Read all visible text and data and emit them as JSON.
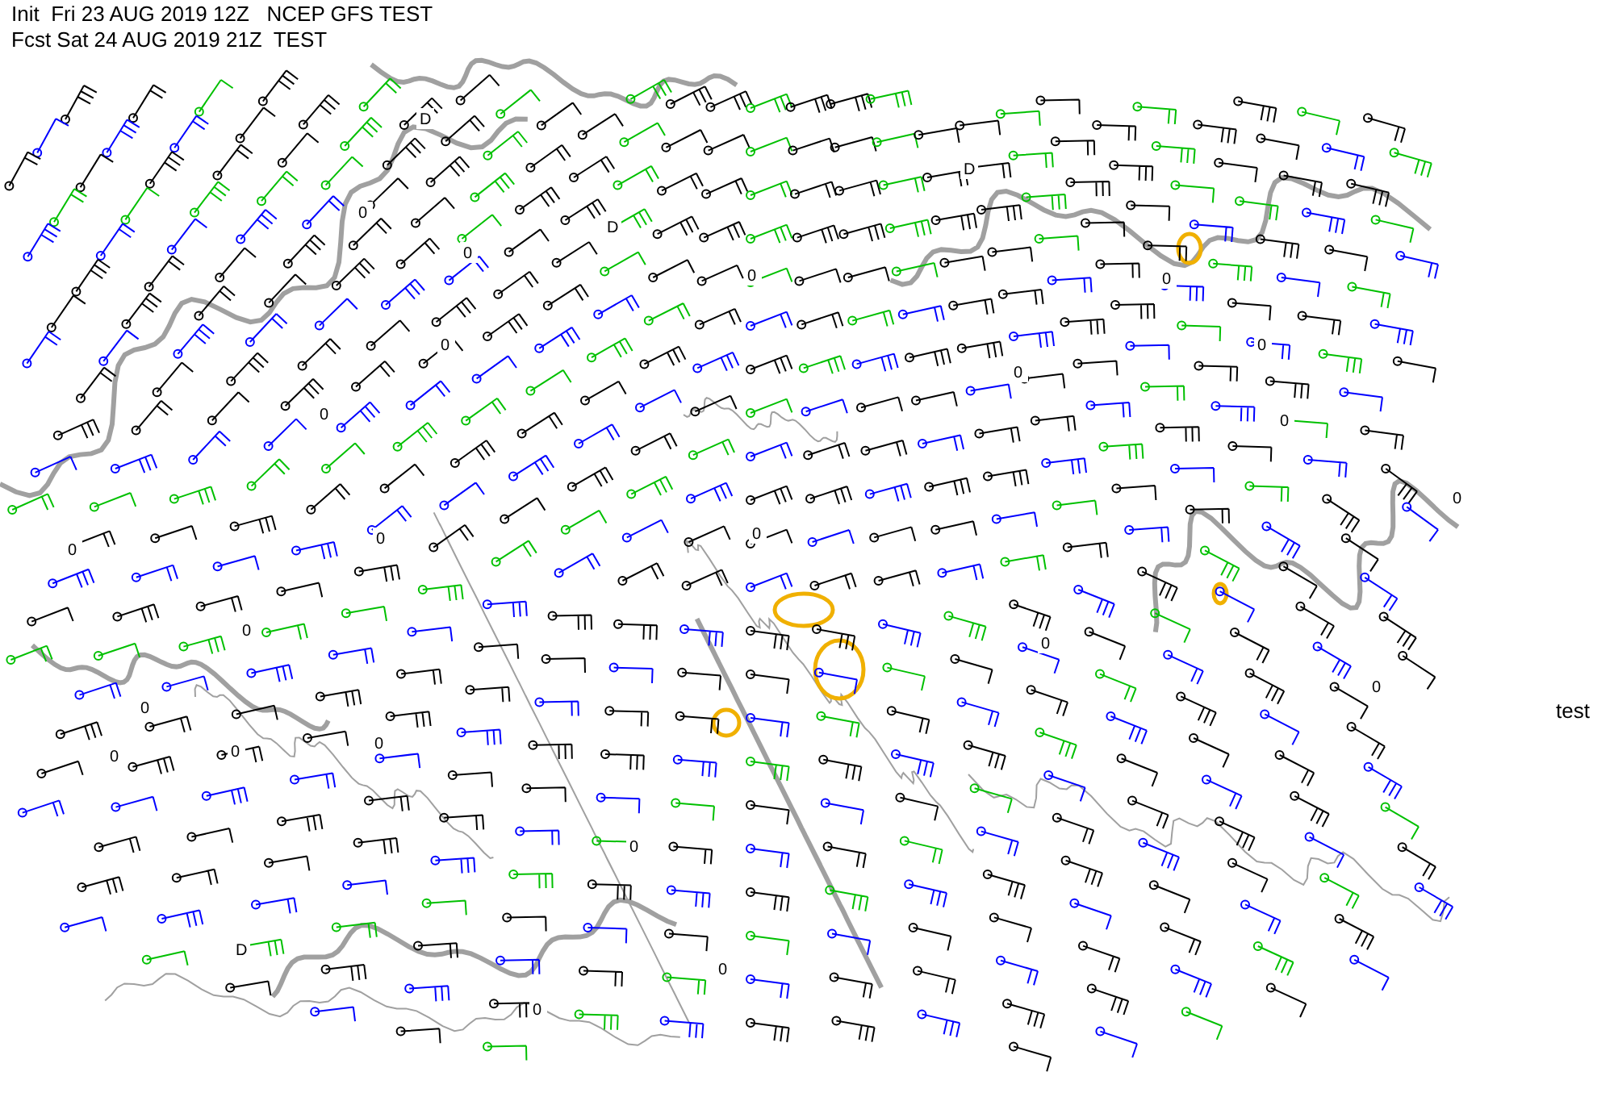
{
  "header": {
    "lines": [
      "Init  Fri 23 AUG 2019 12Z   NCEP GFS TEST",
      "Fcst Sat 24 AUG 2019 21Z  TEST"
    ]
  },
  "side_label": "test",
  "map": {
    "contour_labels": [
      "D",
      "D",
      "D",
      "0",
      "0",
      "0",
      "0",
      "0",
      "0",
      "0",
      "0",
      "0",
      "0",
      "0",
      "0",
      "0",
      "0",
      "0",
      "0",
      "0",
      "0",
      "0",
      "0",
      "0",
      "0",
      "0",
      "D"
    ]
  }
}
